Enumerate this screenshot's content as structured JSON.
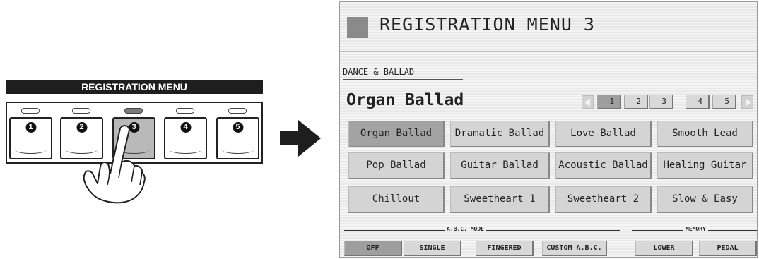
{
  "panel": {
    "label": "REGISTRATION MENU",
    "buttons": [
      {
        "number": "1",
        "lit": false
      },
      {
        "number": "2",
        "lit": false
      },
      {
        "number": "3",
        "lit": true
      },
      {
        "number": "4",
        "lit": false
      },
      {
        "number": "5",
        "lit": false
      }
    ]
  },
  "screen": {
    "title": "REGISTRATION MENU 3",
    "category": "DANCE & BALLAD",
    "current_registration": "Organ Ballad",
    "pages": [
      "1",
      "2",
      "3",
      "4",
      "5"
    ],
    "active_page": "1",
    "registrations": [
      [
        "Organ Ballad",
        "Dramatic Ballad",
        "Love Ballad",
        "Smooth Lead"
      ],
      [
        "Pop Ballad",
        "Guitar Ballad",
        "Acoustic Ballad",
        "Healing Guitar"
      ],
      [
        "Chillout",
        "Sweetheart 1",
        "Sweetheart 2",
        "Slow & Easy"
      ]
    ],
    "selected_registration": "Organ Ballad",
    "abc_mode": {
      "label": "A.B.C. MODE",
      "buttons": [
        "OFF",
        "SINGLE",
        "FINGERED",
        "CUSTOM A.B.C."
      ],
      "active": "OFF"
    },
    "memory": {
      "label": "MEMORY",
      "buttons": [
        "LOWER",
        "PEDAL"
      ]
    }
  },
  "colors": {
    "selected": "#a3a3a3",
    "button": "#d4d4d4",
    "screen_bg": "#efefef"
  }
}
